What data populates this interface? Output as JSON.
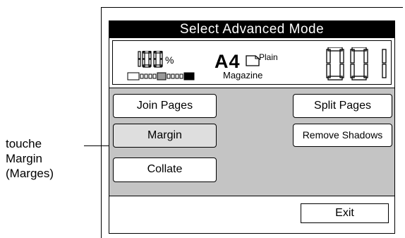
{
  "callout": {
    "line1": "touche",
    "line2": "Margin",
    "line3": "(Marges)"
  },
  "panel": {
    "title": "Select  Advanced  Mode",
    "status": {
      "zoom_display": "100",
      "zoom_unit": "%",
      "paper_size": "A4",
      "paper_type": "Plain",
      "copies_display": "001",
      "document_type": "Magazine"
    },
    "buttons": {
      "join_pages": "Join Pages",
      "margin": "Margin",
      "collate": "Collate",
      "split_pages": "Split Pages",
      "remove_shadows": "Remove Shadows",
      "exit": "Exit"
    }
  },
  "colors": {
    "title_bg": "#000000",
    "title_fg": "#ffffff",
    "body_bg": "#c4c4c4",
    "selected_button": "#dedede"
  }
}
